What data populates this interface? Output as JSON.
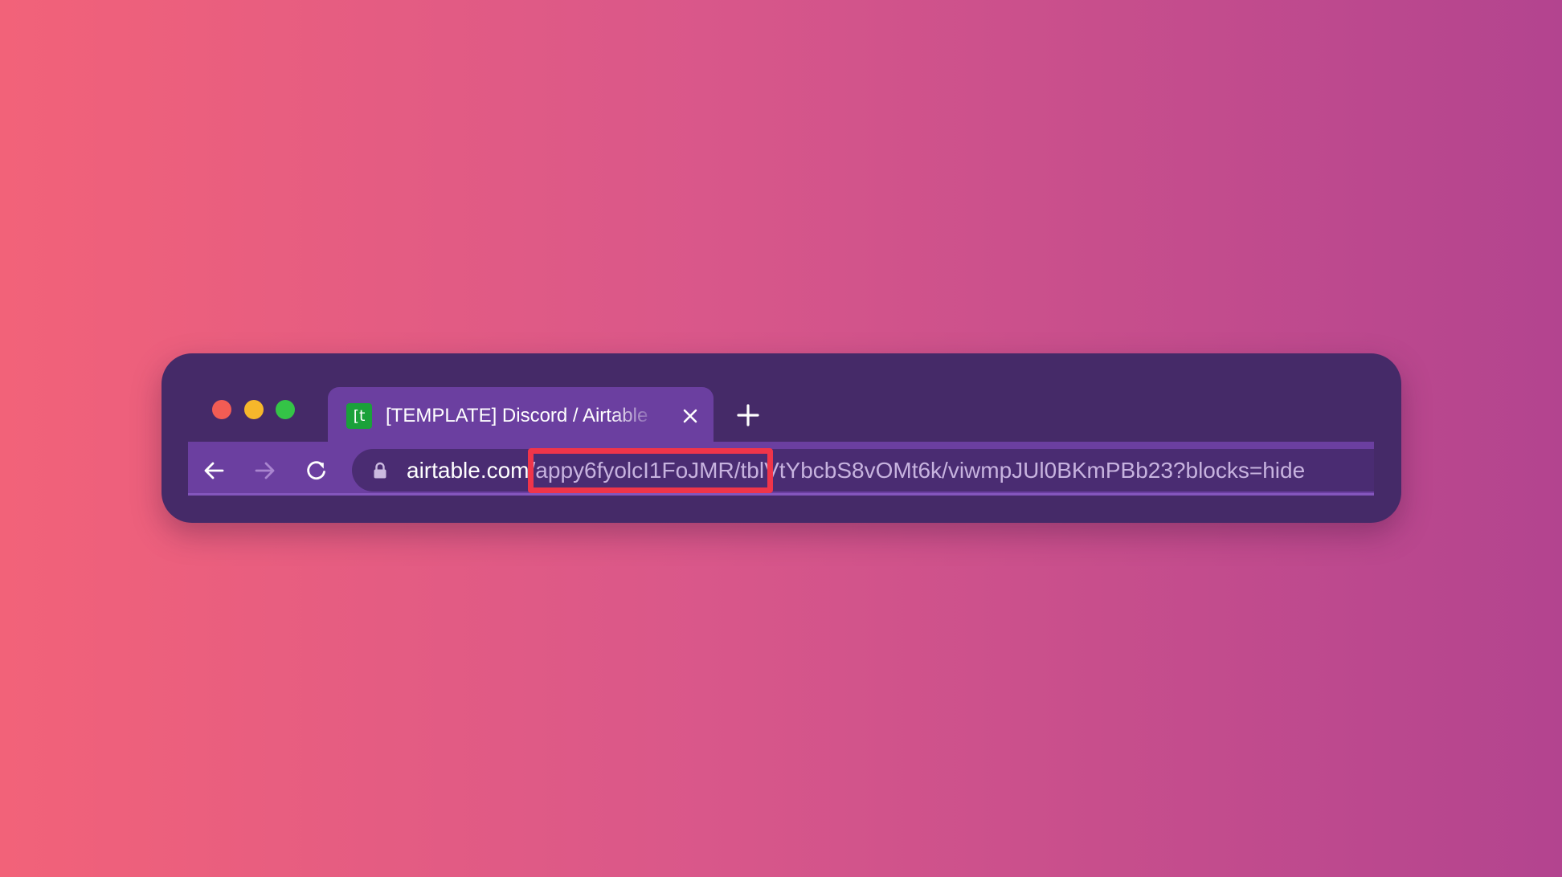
{
  "browser": {
    "tab": {
      "favicon_text": "[t",
      "favicon_color": "#1aa13a",
      "title": "[TEMPLATE] Discord / Airtable",
      "close_icon": "close-icon"
    },
    "new_tab_icon": "plus-icon",
    "nav": {
      "back_icon": "arrow-left-icon",
      "forward_icon": "arrow-right-icon",
      "reload_icon": "reload-icon"
    },
    "address_bar": {
      "lock_icon": "lock-icon",
      "domain": "airtable.com",
      "path": "/appy6fyolcI1FoJMR/tblVtYbcbS8vOMt6k/viwmpJUl0BKmPBb23?blocks=hide"
    },
    "highlight": {
      "color": "#f0354a",
      "highlighted_text": "/appy6fyolcI1FoJMR/"
    }
  },
  "colors": {
    "window_frame": "#452a68",
    "toolbar": "#6b3fa0",
    "background_gradient_start": "#f26279",
    "background_gradient_end": "#b3448f"
  }
}
